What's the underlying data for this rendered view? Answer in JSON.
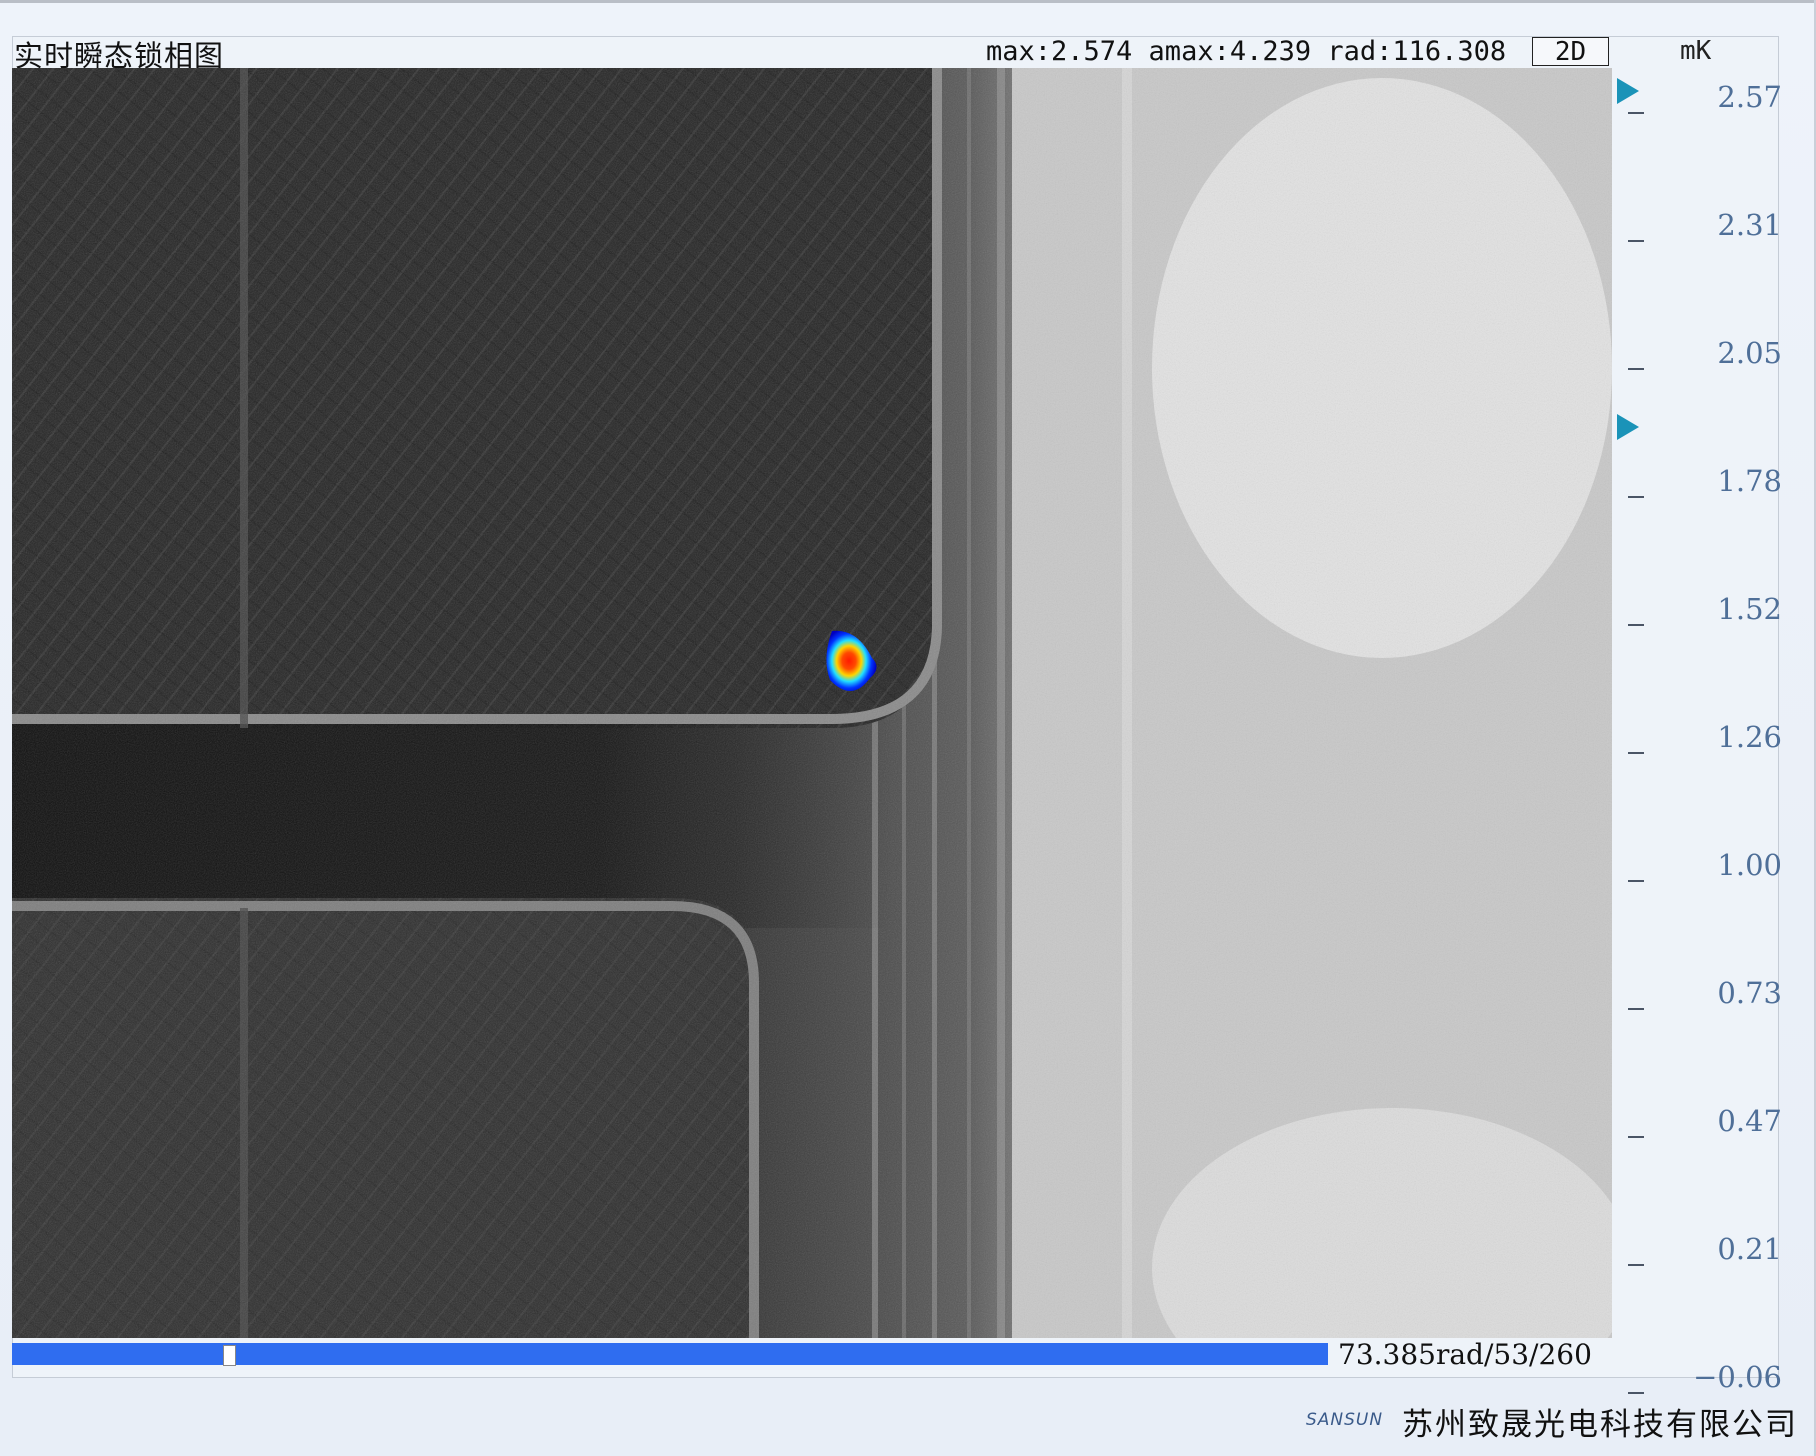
{
  "header": {
    "title": "实时瞬态锁相图",
    "status": "max:2.574 amax:4.239 rad:116.308",
    "mode_button": "2D",
    "unit": "mK"
  },
  "scale": {
    "labels": [
      "2.57",
      "2.31",
      "2.05",
      "1.78",
      "1.52",
      "1.26",
      "1.00",
      "0.73",
      "0.47",
      "0.21",
      "−0.06"
    ],
    "marker_values": [
      2.57,
      1.88
    ]
  },
  "progress": {
    "text": "73.385rad/53/260",
    "fraction": 0.16
  },
  "footer": {
    "brand": "SANSUN",
    "company": "苏州致晟光电科技有限公司"
  },
  "colors": {
    "accent_blue": "#2f6df0",
    "marker_teal": "#1a93b8",
    "scale_text": "#4f6f98"
  }
}
